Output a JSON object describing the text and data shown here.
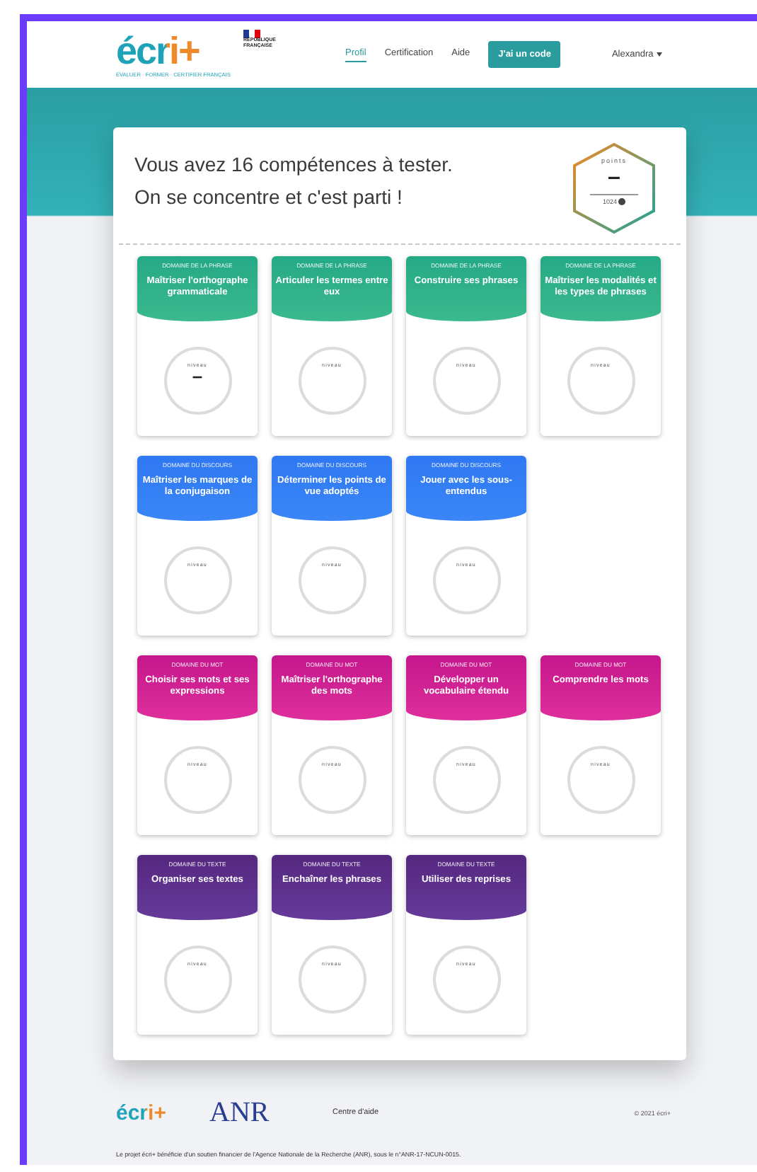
{
  "header": {
    "logo": "écri+",
    "logo_tagline": "ÉVALUER · FORMER · CERTIFIER FRANÇAIS",
    "republic": "RÉPUBLIQUE FRANÇAISE",
    "nav": [
      {
        "label": "Profil",
        "selected": true
      },
      {
        "label": "Certification",
        "selected": false
      },
      {
        "label": "Aide",
        "selected": false
      }
    ],
    "code_button": "J'ai un code",
    "user": "Alexandra"
  },
  "intro": {
    "line_1": "Vous avez 16 compétences à tester.",
    "line_2": "On se concentre et c'est parti !"
  },
  "points": {
    "label": "points",
    "value": "–",
    "total": "1024"
  },
  "groups": [
    {
      "kind": "phrase",
      "skills": [
        {
          "domain": "DOMAINE DE LA PHRASE",
          "title": "Maîtriser l'orthographe grammaticale",
          "level_label": "niveau",
          "level_value": "–"
        },
        {
          "domain": "DOMAINE DE LA PHRASE",
          "title": "Articuler les termes entre eux",
          "level_label": "niveau"
        },
        {
          "domain": "DOMAINE DE LA PHRASE",
          "title": "Construire ses phrases",
          "level_label": "niveau"
        },
        {
          "domain": "DOMAINE DE LA PHRASE",
          "title": "Maîtriser les modalités et les types de phrases",
          "level_label": "niveau"
        }
      ]
    },
    {
      "kind": "discours",
      "skills": [
        {
          "domain": "DOMAINE DU DISCOURS",
          "title": "Maîtriser les marques de la conjugaison",
          "level_label": "niveau"
        },
        {
          "domain": "DOMAINE DU DISCOURS",
          "title": "Déterminer les points de vue adoptés",
          "level_label": "niveau"
        },
        {
          "domain": "DOMAINE DU DISCOURS",
          "title": "Jouer avec les sous-entendus",
          "level_label": "niveau"
        }
      ]
    },
    {
      "kind": "mot",
      "skills": [
        {
          "domain": "DOMAINE DU MOT",
          "title": "Choisir ses mots et ses expressions",
          "level_label": "niveau"
        },
        {
          "domain": "DOMAINE DU MOT",
          "title": "Maîtriser l'orthographe des mots",
          "level_label": "niveau"
        },
        {
          "domain": "DOMAINE DU MOT",
          "title": "Développer un vocabulaire étendu",
          "level_label": "niveau"
        },
        {
          "domain": "DOMAINE DU MOT",
          "title": "Comprendre les mots",
          "level_label": "niveau"
        }
      ]
    },
    {
      "kind": "texte",
      "skills": [
        {
          "domain": "DOMAINE DU TEXTE",
          "title": "Organiser ses textes",
          "level_label": "niveau"
        },
        {
          "domain": "DOMAINE DU TEXTE",
          "title": "Enchaîner les phrases",
          "level_label": "niveau"
        },
        {
          "domain": "DOMAINE DU TEXTE",
          "title": "Utiliser des reprises",
          "level_label": "niveau"
        }
      ]
    }
  ],
  "footer": {
    "logo": "écri+",
    "partner_logo": "ANR",
    "help_link": "Centre d'aide",
    "copyright": "© 2021 écri+",
    "funding": "Le projet écri+ bénéficie d'un soutien financier de l'Agence Nationale de la Recherche (ANR), sous le n°ANR-17-NCUN-0015."
  }
}
